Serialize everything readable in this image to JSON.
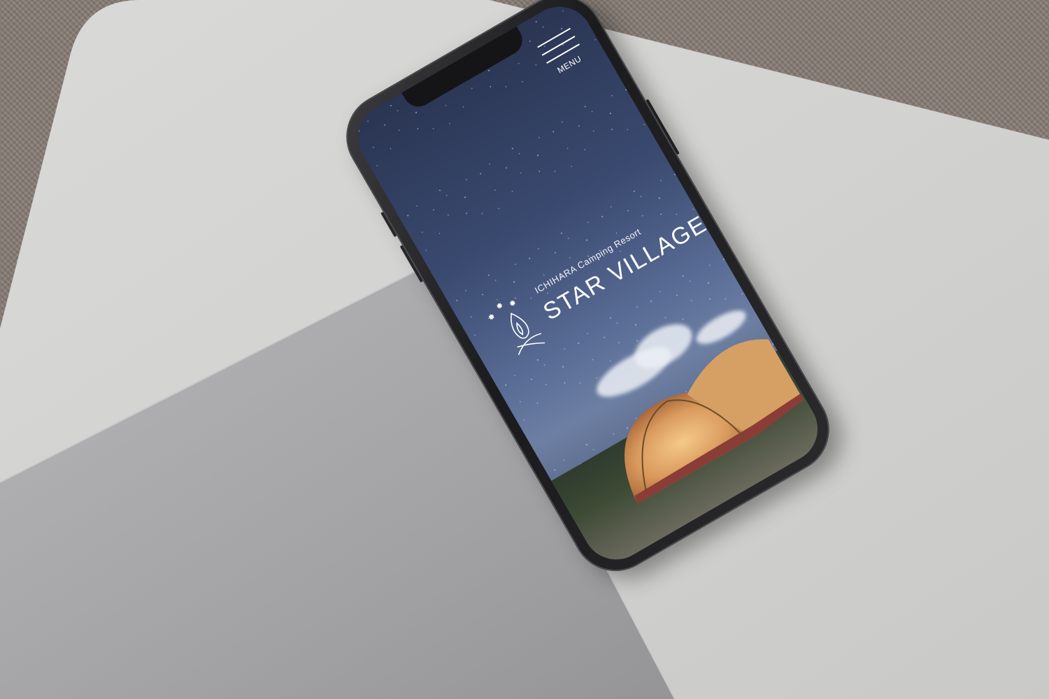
{
  "site": {
    "subtitle": "ICHIHARA Camping Resort",
    "title": "STAR VILLAGE"
  },
  "header": {
    "menu_label": "MENU"
  },
  "colors": {
    "table": "#d6d6d4",
    "laptop": "#a7a7a9",
    "phone_frame": "#1e1e21",
    "sky_top": "#2a3552",
    "text": "#ffffff"
  },
  "icons": {
    "logo": "campfire-stars-icon",
    "menu": "hamburger-menu-icon"
  }
}
